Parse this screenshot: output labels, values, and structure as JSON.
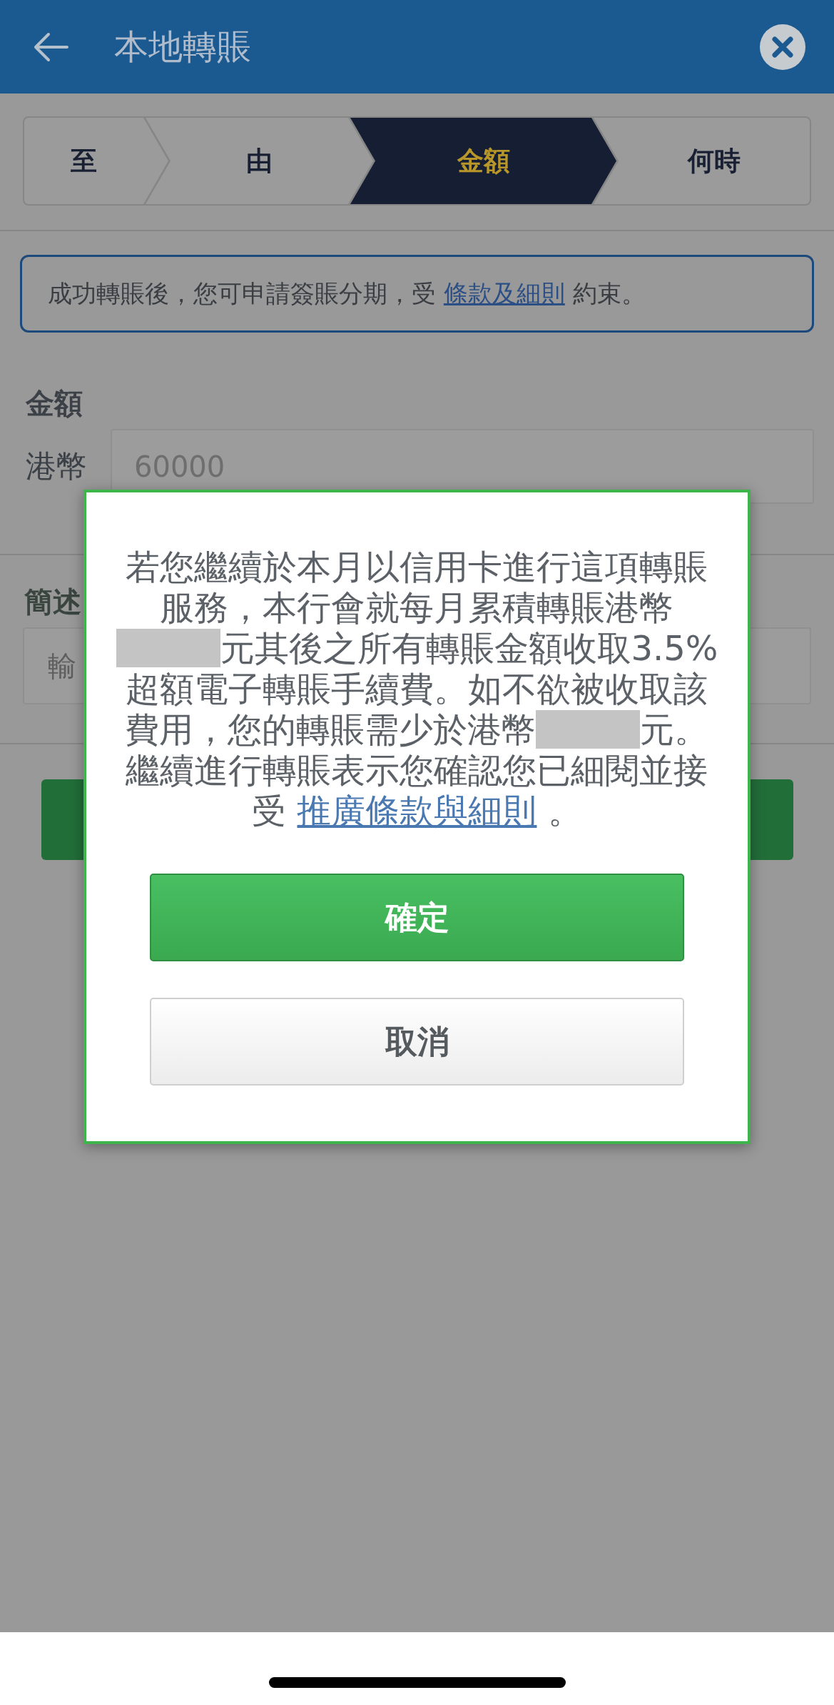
{
  "app_bar": {
    "title": "本地轉賬"
  },
  "steps": [
    {
      "label": "至",
      "selected": false
    },
    {
      "label": "由",
      "selected": false
    },
    {
      "label": "金額",
      "selected": true
    },
    {
      "label": "何時",
      "selected": false
    }
  ],
  "notice": {
    "segments": [
      {
        "kind": "text",
        "text": "成功轉賬後，您可申請簽賬分期，受 "
      },
      {
        "kind": "link",
        "text": "條款及細則"
      },
      {
        "kind": "text",
        "text": " 約束。"
      }
    ]
  },
  "amount": {
    "label": "金額",
    "currency": "港幣",
    "value": "60000"
  },
  "description": {
    "label": "簡述",
    "placeholder": "輸"
  },
  "dialog": {
    "lines": [
      [
        {
          "kind": "text",
          "text": "若您繼續於本月以信用卡進行這項轉賬"
        }
      ],
      [
        {
          "kind": "text",
          "text": "服務，本行會就每月累積轉賬港幣"
        }
      ],
      [
        {
          "kind": "redacted"
        },
        {
          "kind": "text",
          "text": "元其後之所有轉賬金額收取3.5%"
        }
      ],
      [
        {
          "kind": "text",
          "text": "超額電子轉賬手續費。如不欲被收取該"
        }
      ],
      [
        {
          "kind": "text",
          "text": "費用，您的轉賬需少於港幣"
        },
        {
          "kind": "redacted"
        },
        {
          "kind": "text",
          "text": "元。"
        }
      ],
      [
        {
          "kind": "text",
          "text": "繼續進行轉賬表示您確認您已細閱並接"
        }
      ],
      [
        {
          "kind": "text",
          "text": "受 "
        },
        {
          "kind": "link",
          "text": "推廣條款與細則"
        },
        {
          "kind": "text",
          "text": " 。"
        }
      ]
    ],
    "buttons": [
      {
        "label": "確定",
        "kind": "primary"
      },
      {
        "label": "取消",
        "kind": "secondary"
      }
    ]
  }
}
